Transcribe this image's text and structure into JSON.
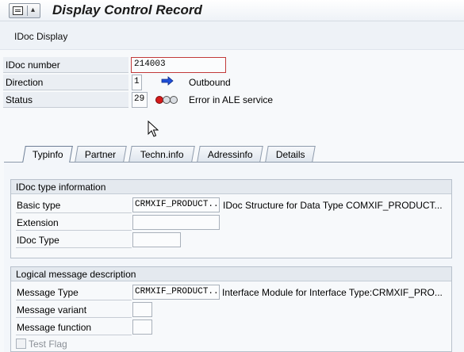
{
  "window": {
    "title": "Display Control Record"
  },
  "toolbar": {
    "idoc_display": "IDoc Display"
  },
  "header": {
    "idoc_number_label": "IDoc number",
    "idoc_number_value": "214003",
    "direction_label": "Direction",
    "direction_value": "1",
    "direction_text": "Outbound",
    "status_label": "Status",
    "status_value": "29",
    "status_text": "Error in ALE service",
    "status_light": "red"
  },
  "tabs": [
    {
      "label": "Typinfo",
      "active": true
    },
    {
      "label": "Partner",
      "active": false
    },
    {
      "label": "Techn.info",
      "active": false
    },
    {
      "label": "Adressinfo",
      "active": false
    },
    {
      "label": "Details",
      "active": false
    }
  ],
  "type_info": {
    "title": "IDoc type information",
    "basic_type_label": "Basic type",
    "basic_type_value": "CRMXIF_PRODUCT...",
    "basic_type_desc": "IDoc Structure for Data Type COMXIF_PRODUCT...",
    "extension_label": "Extension",
    "extension_value": "",
    "idoc_type_label": "IDoc Type",
    "idoc_type_value": ""
  },
  "message": {
    "title": "Logical message description",
    "message_type_label": "Message Type",
    "message_type_value": "CRMXIF_PRODUCT...",
    "message_type_desc": "Interface Module for Interface Type:CRMXIF_PRO...",
    "variant_label": "Message variant",
    "variant_value": "",
    "function_label": "Message function",
    "function_value": "",
    "test_flag_label": "Test Flag",
    "test_flag_checked": false
  },
  "colors": {
    "accent_arrow": "#1f4fd8",
    "status_red": "#d51a1a"
  }
}
